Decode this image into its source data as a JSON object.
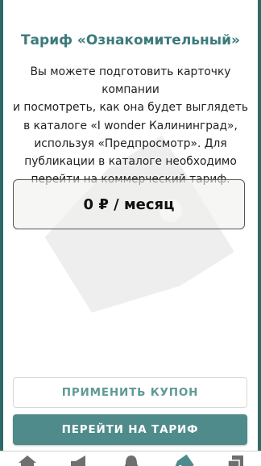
{
  "title": "Тариф «Ознакомительный»",
  "description_lines": [
    "Вы можете подготовить карточку компании",
    "и посмотреть, как она будет выглядеть",
    "в каталоге «I wonder Калининград»,",
    "используя «Предпросмотр». Для",
    "публикации в каталоге необходимо",
    "перейти на коммерческий тариф."
  ],
  "price": "0 ₽ / месяц",
  "buttons": {
    "coupon": "ПРИМЕНИТЬ КУПОН",
    "go_tariff": "ПЕРЕЙТИ НА ТАРИФ"
  },
  "tabbar": {
    "items": [
      {
        "icon": "home-icon",
        "active": false
      },
      {
        "icon": "megaphone-icon",
        "active": false
      },
      {
        "icon": "bell-icon",
        "active": false
      },
      {
        "icon": "tag-icon",
        "active": true
      },
      {
        "icon": "pages-icon",
        "active": false
      }
    ]
  },
  "colors": {
    "accent": "#4e8b8a",
    "title": "#3d7a7a",
    "side_bar": "#2e6a6a"
  }
}
